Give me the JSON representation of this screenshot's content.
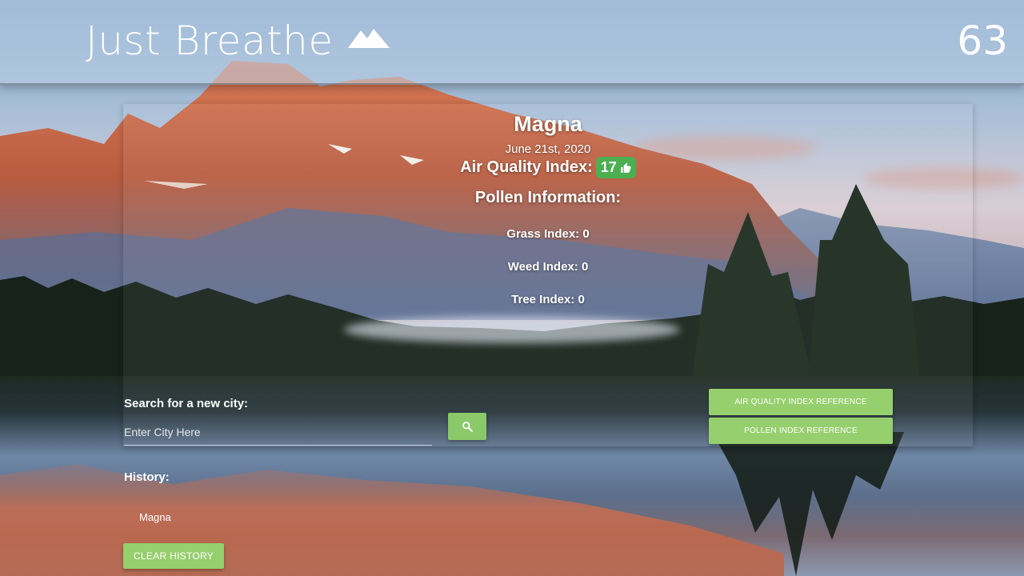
{
  "header": {
    "brand": "Just Breathe",
    "brand_icon": "mountain-icon",
    "number": "63"
  },
  "current": {
    "city": "Magna",
    "date": "June 21st, 2020",
    "aqi_label": "Air Quality Index:",
    "aqi_value": "17",
    "aqi_icon": "thumbs-up-icon",
    "aqi_color": "#4caf50",
    "pollen_heading": "Pollen Information:",
    "grass": "Grass Index: 0",
    "weed": "Weed Index: 0",
    "tree": "Tree Index: 0"
  },
  "search": {
    "label": "Search for a new city:",
    "placeholder": "Enter City Here",
    "button_icon": "search-icon"
  },
  "references": {
    "aqi_button": "AIR QUALITY INDEX REFERENCE",
    "pollen_button": "POLLEN INDEX REFERENCE",
    "color": "#96cf6d"
  },
  "history": {
    "label": "History:",
    "items": [
      "Magna"
    ],
    "clear_button": "CLEAR HISTORY"
  }
}
